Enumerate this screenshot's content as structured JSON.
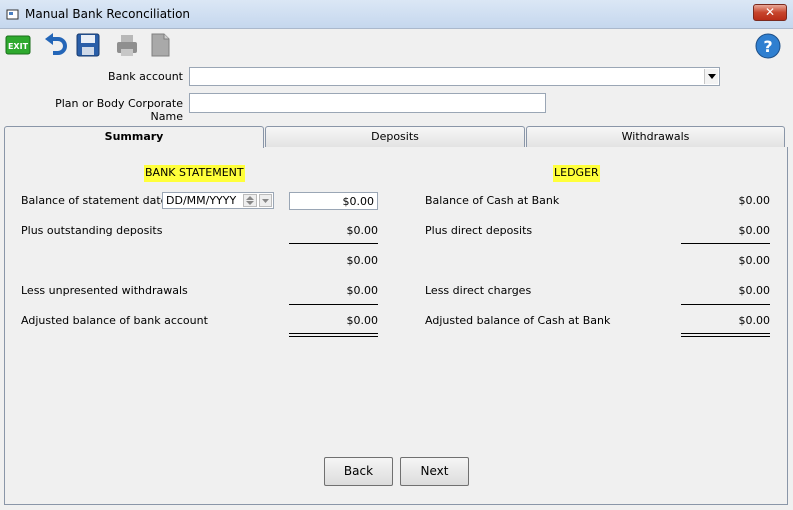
{
  "window": {
    "title": "Manual Bank Reconciliation",
    "close_glyph": "✕"
  },
  "toolbar": {
    "exit_label": "EXIT",
    "icons": [
      "exit-icon",
      "undo-icon",
      "save-icon",
      "print-icon",
      "document-icon",
      "help-icon"
    ],
    "help_glyph": "?"
  },
  "form": {
    "bank_account_label": "Bank account",
    "bank_account_value": "",
    "plan_label": "Plan or Body Corporate Name",
    "plan_value": ""
  },
  "tabs": [
    {
      "label": "Summary",
      "active": true
    },
    {
      "label": "Deposits",
      "active": false
    },
    {
      "label": "Withdrawals",
      "active": false
    }
  ],
  "bank_statement": {
    "heading": "BANK STATEMENT",
    "balance_label": "Balance of statement dated",
    "date_placeholder": "DD/MM/YYYY",
    "balance_value": "$0.00",
    "plus_deposits_label": "Plus outstanding deposits",
    "plus_deposits_value": "$0.00",
    "subtotal_value": "$0.00",
    "less_withdrawals_label": "Less unpresented withdrawals",
    "less_withdrawals_value": "$0.00",
    "adjusted_label": "Adjusted balance of bank account",
    "adjusted_value": "$0.00"
  },
  "ledger": {
    "heading": "LEDGER",
    "balance_label": "Balance of Cash at Bank",
    "balance_value": "$0.00",
    "plus_direct_label": "Plus direct deposits",
    "plus_direct_value": "$0.00",
    "subtotal_value": "$0.00",
    "less_direct_label": "Less direct charges",
    "less_direct_value": "$0.00",
    "adjusted_label": "Adjusted balance of Cash at Bank",
    "adjusted_value": "$0.00"
  },
  "footer": {
    "back_label": "Back",
    "next_label": "Next"
  },
  "colors": {
    "highlight": "#ffff3a",
    "exit_green": "#2ea92e",
    "help_blue": "#2f7fd0"
  }
}
